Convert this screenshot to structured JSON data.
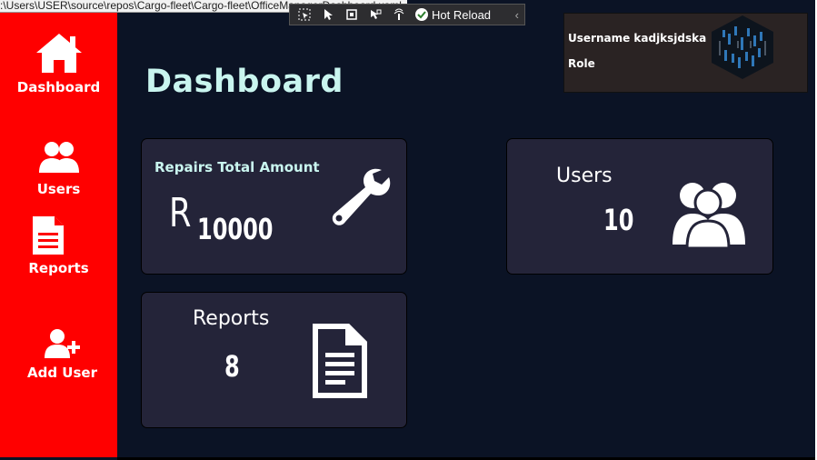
{
  "devtools": {
    "path_tooltip": ":\\Users\\USER\\source\\repos\\Cargo-fleet\\Cargo-fleet\\OfficeManagerDashboard.xaml",
    "hot_reload_label": "Hot Reload"
  },
  "sidebar": {
    "items": [
      {
        "label": "Dashboard",
        "icon": "home-icon"
      },
      {
        "label": "Users",
        "icon": "users-icon"
      },
      {
        "label": "Reports",
        "icon": "document-icon"
      },
      {
        "label": "Add User",
        "icon": "add-user-icon"
      }
    ]
  },
  "page": {
    "title": "Dashboard"
  },
  "user_info": {
    "username_label": "Username kadjksjdska",
    "role_label": "Role"
  },
  "cards": {
    "repairs": {
      "title": "Repairs Total Amount",
      "currency": "R",
      "amount": "10000",
      "icon": "wrench-icon"
    },
    "users": {
      "title": "Users",
      "count": "10",
      "icon": "users-icon"
    },
    "reports": {
      "title": "Reports",
      "count": "8",
      "icon": "document-icon"
    }
  },
  "colors": {
    "sidebar_bg": "#ff0000",
    "main_bg": "#0b1325",
    "card_bg": "#242439",
    "title_color": "#c9f5ef"
  }
}
